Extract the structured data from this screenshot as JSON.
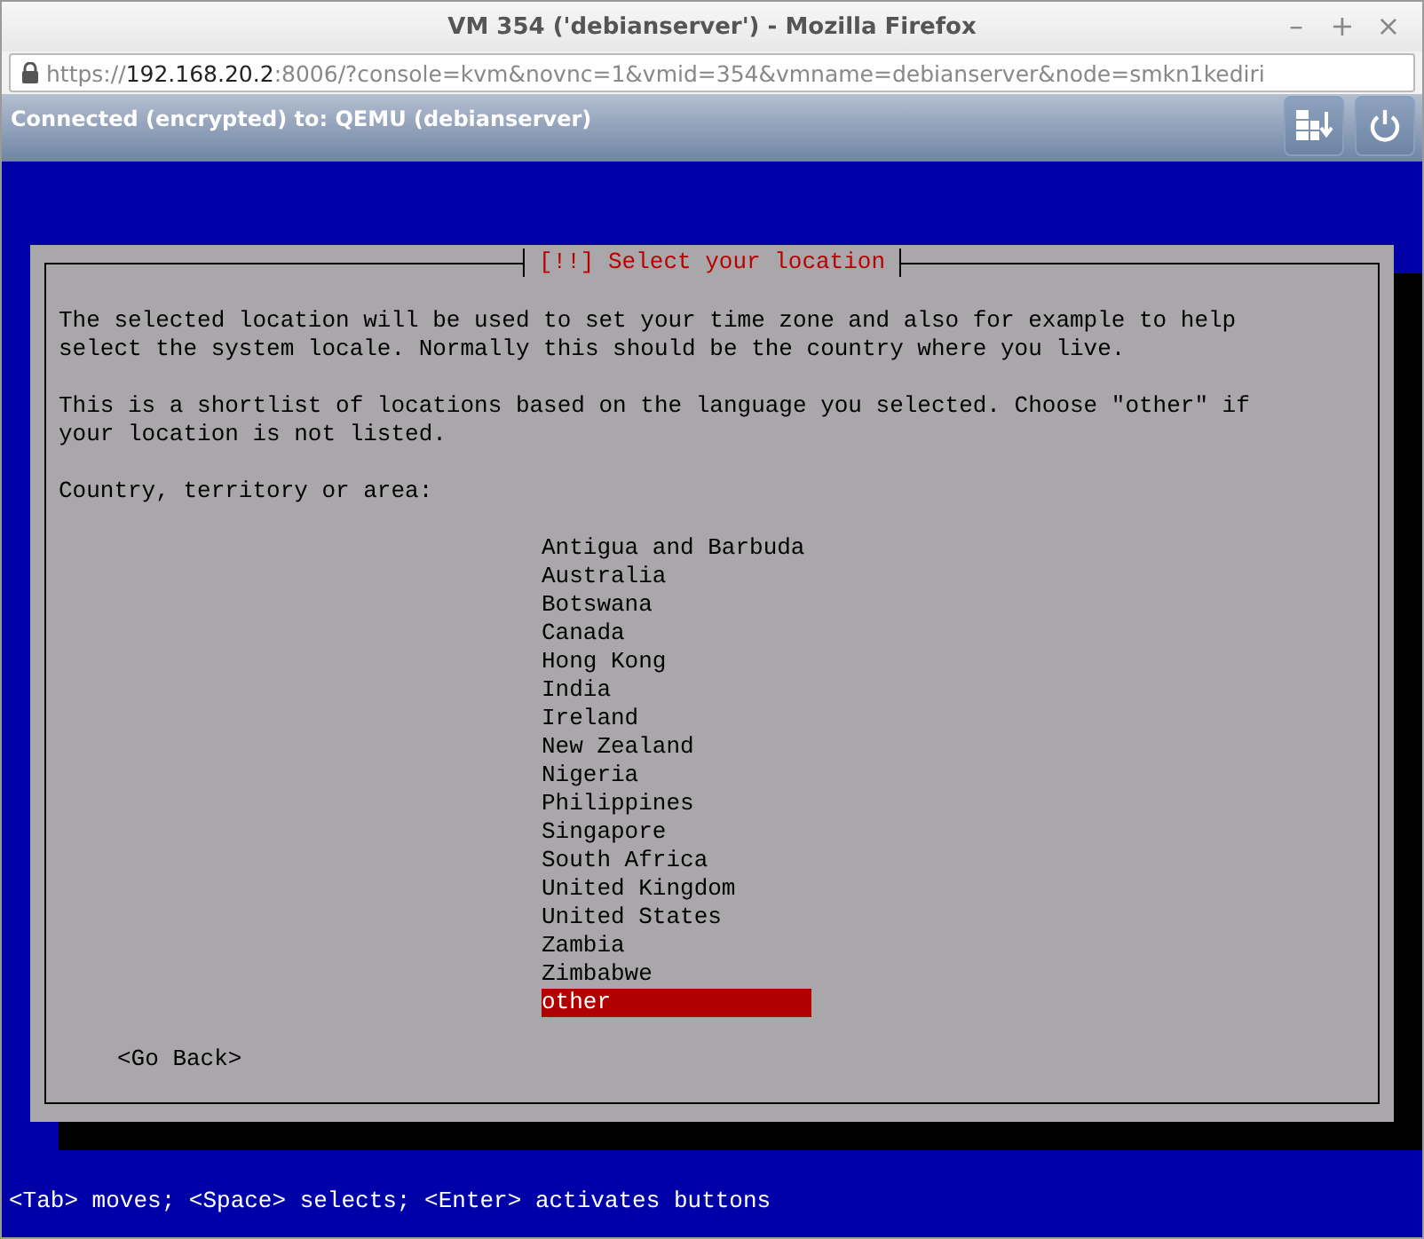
{
  "window": {
    "title": "VM 354 ('debianserver') - Mozilla Firefox",
    "controls": [
      "–",
      "+",
      "×"
    ]
  },
  "address_bar": {
    "scheme": "https://",
    "host": "192.168.20.2",
    "rest": ":8006/?console=kvm&novnc=1&vmid=354&vmname=debianserver&node=smkn1kediri"
  },
  "vnc_bar": {
    "status": "Connected (encrypted) to: QEMU (debianserver)"
  },
  "dialog": {
    "title": "[!!] Select your location",
    "paragraphs": [
      "The selected location will be used to set your time zone and also for example to help\nselect the system locale. Normally this should be the country where you live.",
      "This is a shortlist of locations based on the language you selected. Choose \"other\" if\nyour location is not listed."
    ],
    "prompt": "Country, territory or area:",
    "options": [
      {
        "label": "Antigua and Barbuda",
        "selected": false
      },
      {
        "label": "Australia",
        "selected": false
      },
      {
        "label": "Botswana",
        "selected": false
      },
      {
        "label": "Canada",
        "selected": false
      },
      {
        "label": "Hong Kong",
        "selected": false
      },
      {
        "label": "India",
        "selected": false
      },
      {
        "label": "Ireland",
        "selected": false
      },
      {
        "label": "New Zealand",
        "selected": false
      },
      {
        "label": "Nigeria",
        "selected": false
      },
      {
        "label": "Philippines",
        "selected": false
      },
      {
        "label": "Singapore",
        "selected": false
      },
      {
        "label": "South Africa",
        "selected": false
      },
      {
        "label": "United Kingdom",
        "selected": false
      },
      {
        "label": "United States",
        "selected": false
      },
      {
        "label": "Zambia",
        "selected": false
      },
      {
        "label": "Zimbabwe",
        "selected": false
      },
      {
        "label": "other",
        "selected": true
      }
    ],
    "back_button": "<Go Back>"
  },
  "help_line": "<Tab> moves; <Space> selects; <Enter> activates buttons"
}
